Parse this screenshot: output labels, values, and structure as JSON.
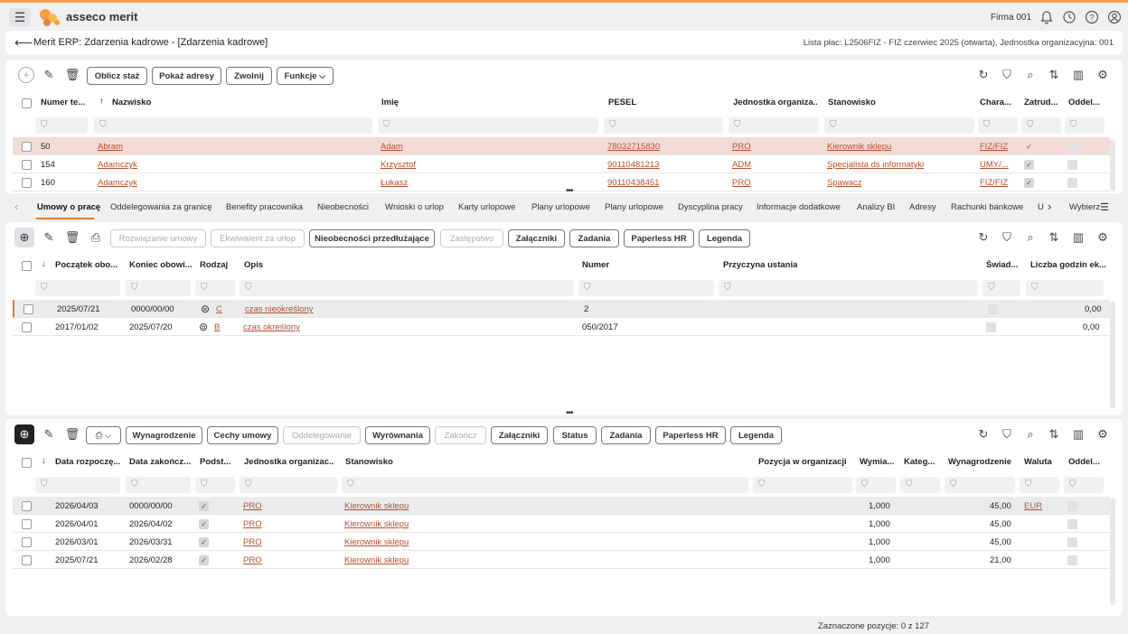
{
  "app": {
    "brand": "asseco merit",
    "company": "Firma 001"
  },
  "header": {
    "title": "Merit ERP: Zdarzenia kadrowe - [Zdarzenia kadrowe]",
    "info": "Lista płac: L2506FIZ - FIZ czerwiec 2025 (otwarta), Jednostka organizacyjna: 001"
  },
  "top": {
    "buttons": [
      "Oblicz staż",
      "Pokaż adresy",
      "Zwolnij",
      "Funkcje"
    ],
    "columns": [
      "Numer te...",
      "Nazwisko",
      "Imię",
      "PESEL",
      "Jednostka organiza...",
      "Stanowisko",
      "Chara...",
      "Zatrud...",
      "Oddel..."
    ],
    "rows": [
      {
        "num": "50",
        "surname": "Abram",
        "name": "Adam",
        "pesel": "78032715830",
        "unit": "PRO",
        "position": "Kierownik sklepu",
        "char": "FIZ/FIZ",
        "emp": "✓"
      },
      {
        "num": "154",
        "surname": "Adamczyk",
        "name": "Krzysztof",
        "pesel": "90110481213",
        "unit": "ADM",
        "position": "Specjalista ds informatyki",
        "char": "UMY/...",
        "emp": "✓"
      },
      {
        "num": "160",
        "surname": "Adamczyk",
        "name": "Łukasz",
        "pesel": "90110438451",
        "unit": "PRO",
        "position": "Spawacz",
        "char": "FIZ/FIZ",
        "emp": "✓"
      }
    ]
  },
  "tabs": [
    "Umowy o pracę",
    "Oddelegowania za granicę",
    "Benefity pracownika",
    "Nieobecności",
    "Wnioski o urlop",
    "Karty urlopowe",
    "Plany urlopowe",
    "Plany urlopowe",
    "Dyscyplina pracy",
    "Informacje dodatkowe",
    "Analizy BI",
    "Adresy",
    "Rachunki bankowe",
    "U",
    "Wybierz"
  ],
  "middle": {
    "buttons": [
      "Rozwiązanie umowy",
      "Ekwiwalent za urlop",
      "Nieobecności przedłużające",
      "Zastępstwo",
      "Załączniki",
      "Zadania",
      "Paperless HR",
      "Legenda"
    ],
    "columns": [
      "Początek obo...",
      "Koniec obowi...",
      "Rodzaj",
      "Opis",
      "Numer",
      "Przyczyna ustania",
      "Świad...",
      "Liczba godzin ek..."
    ],
    "rows": [
      {
        "start": "2025/07/21",
        "end": "0000/00/00",
        "type": "C",
        "desc": "czas nieokreślony",
        "number": "2",
        "hours": "0,00"
      },
      {
        "start": "2017/01/02",
        "end": "2025/07/20",
        "type": "B",
        "desc": "czas określony",
        "number": "050/2017",
        "hours": "0,00"
      }
    ]
  },
  "bottom": {
    "buttons": [
      "Wynagrodzenie",
      "Cechy umowy",
      "Oddelegowanie",
      "Wyrównania",
      "Zakończ",
      "Załączniki",
      "Status",
      "Zadania",
      "Paperless HR",
      "Legenda"
    ],
    "columns": [
      "Data rozpoczę...",
      "Data zakończ...",
      "Podst...",
      "Jednostka organizac...",
      "Stanowisko",
      "Pozycja w organizacji",
      "Wymia...",
      "Kateg...",
      "Wynagrodzenie",
      "Waluta",
      "Oddel..."
    ],
    "rows": [
      {
        "start": "2026/04/03",
        "end": "0000/00/00",
        "unit": "PRO",
        "position": "Kierownik sklepu",
        "dim": "1,000",
        "salary": "45,00",
        "currency": "EUR"
      },
      {
        "start": "2026/04/01",
        "end": "2026/04/02",
        "unit": "PRO",
        "position": "Kierownik sklepu",
        "dim": "1,000",
        "salary": "45,00",
        "currency": ""
      },
      {
        "start": "2026/03/01",
        "end": "2026/03/31",
        "unit": "PRO",
        "position": "Kierownik sklepu",
        "dim": "1,000",
        "salary": "45,00",
        "currency": ""
      },
      {
        "start": "2025/07/21",
        "end": "2026/02/28",
        "unit": "PRO",
        "position": "Kierownik sklepu",
        "dim": "1,000",
        "salary": "21,00",
        "currency": ""
      }
    ]
  },
  "footer": {
    "selection": "Zaznaczone pozycje: 0 z 127"
  }
}
